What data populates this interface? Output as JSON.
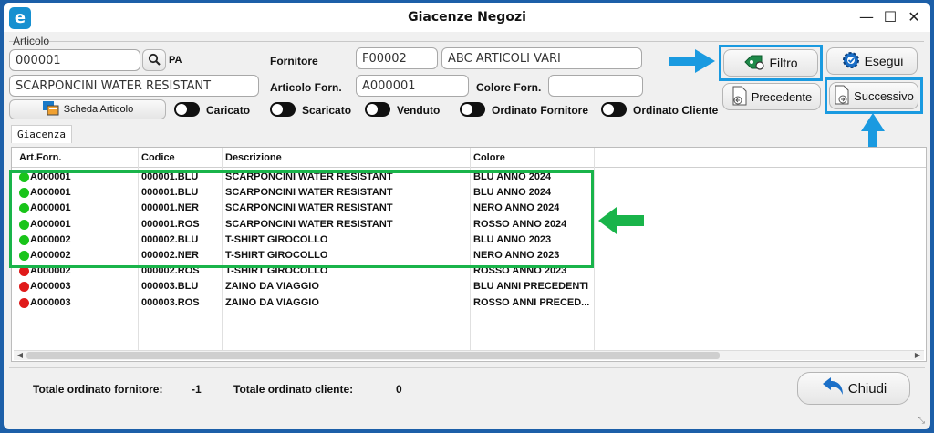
{
  "window": {
    "title": "Giacenze Negozi",
    "app_icon": "e",
    "controls": {
      "minimize": "—",
      "maximize": "☐",
      "close": "✕"
    }
  },
  "filters": {
    "group_label": "Articolo",
    "article_code": "000001",
    "article_code_suffix": "PA",
    "article_description": "SCARPONCINI WATER RESISTANT",
    "supplier_label": "Fornitore",
    "supplier_code": "F00002",
    "supplier_name": "ABC ARTICOLI VARI",
    "supplier_article_label": "Articolo Forn.",
    "supplier_article_value": "A000001",
    "supplier_color_label": "Colore Forn.",
    "supplier_color_value": "",
    "article_card_button": "Scheda Articolo",
    "toggles": [
      {
        "label": "Caricato",
        "on": false
      },
      {
        "label": "Scaricato",
        "on": false
      },
      {
        "label": "Venduto",
        "on": false
      },
      {
        "label": "Ordinato Fornitore",
        "on": false
      },
      {
        "label": "Ordinato Cliente",
        "on": false
      }
    ]
  },
  "actions": {
    "filter_button": "Filtro",
    "execute_button": "Esegui",
    "previous_button": "Precedente",
    "next_button": "Successivo"
  },
  "tab": {
    "label": "Giacenza"
  },
  "grid": {
    "columns": [
      "Art.Forn.",
      "Codice",
      "Descrizione",
      "Colore"
    ],
    "rows": [
      {
        "status": "green",
        "supplier_article": "A000001",
        "code": "000001.BLU",
        "description": "SCARPONCINI WATER RESISTANT",
        "color": "BLU  ANNO 2024"
      },
      {
        "status": "green",
        "supplier_article": "A000001",
        "code": "000001.BLU",
        "description": "SCARPONCINI WATER RESISTANT",
        "color": "BLU  ANNO 2024"
      },
      {
        "status": "green",
        "supplier_article": "A000001",
        "code": "000001.NER",
        "description": "SCARPONCINI WATER RESISTANT",
        "color": "NERO  ANNO 2024"
      },
      {
        "status": "green",
        "supplier_article": "A000001",
        "code": "000001.ROS",
        "description": "SCARPONCINI WATER RESISTANT",
        "color": "ROSSO  ANNO 2024"
      },
      {
        "status": "green",
        "supplier_article": "A000002",
        "code": "000002.BLU",
        "description": "T-SHIRT GIROCOLLO",
        "color": "BLU  ANNO 2023"
      },
      {
        "status": "green",
        "supplier_article": "A000002",
        "code": "000002.NER",
        "description": "T-SHIRT GIROCOLLO",
        "color": "NERO  ANNO 2023"
      },
      {
        "status": "red",
        "supplier_article": "A000002",
        "code": "000002.ROS",
        "description": "T-SHIRT GIROCOLLO",
        "color": "ROSSO  ANNO 2023"
      },
      {
        "status": "red",
        "supplier_article": "A000003",
        "code": "000003.BLU",
        "description": "ZAINO DA VIAGGIO",
        "color": "BLU  ANNI PRECEDENTI"
      },
      {
        "status": "red",
        "supplier_article": "A000003",
        "code": "000003.ROS",
        "description": "ZAINO DA VIAGGIO",
        "color": "ROSSO  ANNI PRECED..."
      }
    ]
  },
  "footer": {
    "total_supplier_label": "Totale ordinato fornitore:",
    "total_supplier_value": "-1",
    "total_customer_label": "Totale ordinato cliente:",
    "total_customer_value": "0",
    "close_button": "Chiudi"
  },
  "colors": {
    "highlight_blue": "#1a9ae0",
    "highlight_green": "#19b44a",
    "status_green": "#19c41a",
    "status_red": "#e01a1a"
  }
}
